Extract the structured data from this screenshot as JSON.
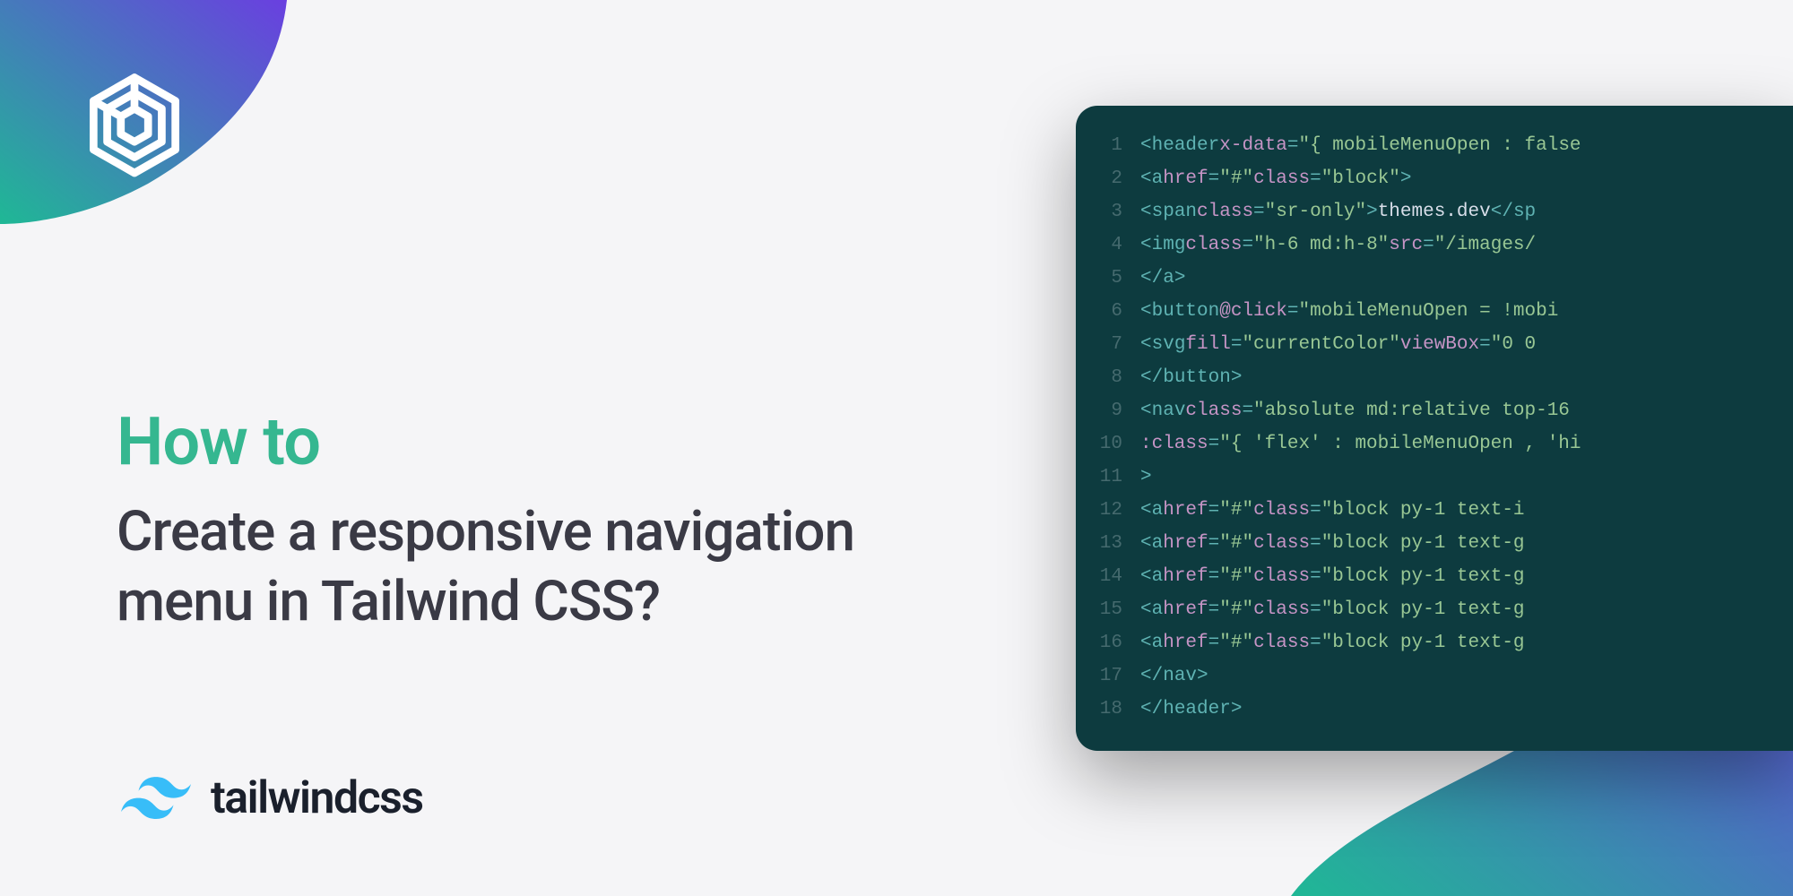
{
  "kicker": "How to",
  "title_line1": "Create a responsive navigation",
  "title_line2": "menu in Tailwind CSS?",
  "tailwind_label": "tailwindcss",
  "code": {
    "l1_tag": "header",
    "l1_attr1": "x-data",
    "l1_val1": "\"{ mobileMenuOpen : false ",
    "l2_tag": "a",
    "l2_attr1": "href",
    "l2_val1": "\"#\"",
    "l2_attr2": "class",
    "l2_val2": "\"block\"",
    "l3_tag": "span",
    "l3_attr1": "class",
    "l3_val1": "\"sr-only\"",
    "l3_text": "themes.dev",
    "l3_close": "sp",
    "l4_tag": "img",
    "l4_attr1": "class",
    "l4_val1": "\"h-6 md:h-8\"",
    "l4_attr2": "src",
    "l4_val2": "\"/images/",
    "l5_tag": "a",
    "l6_tag": "button",
    "l6_attr1": "@click",
    "l6_val1": "\"mobileMenuOpen = !mobi",
    "l7_tag": "svg",
    "l7_attr1": "fill",
    "l7_val1": "\"currentColor\"",
    "l7_attr2": "viewBox",
    "l7_val2": "\"0 0",
    "l8_tag": "button",
    "l9_tag": "nav",
    "l9_attr1": "class",
    "l9_val1": "\"absolute md:relative top-16",
    "l10_attr": ":class",
    "l10_val": "\"{ 'flex' : mobileMenuOpen , 'hi",
    "l11_punc": ">",
    "l12_tag": "a",
    "l12_href": "\"#\"",
    "l12_class_attr": "class",
    "l12_class_val": "\"block py-1 text-i",
    "l13_tag": "a",
    "l13_href": "\"#\"",
    "l13_class_attr": "class",
    "l13_class_val": "\"block py-1 text-g",
    "l14_tag": "a",
    "l14_href": "\"#\"",
    "l14_class_attr": "class",
    "l14_class_val": "\"block py-1 text-g",
    "l15_tag": "a",
    "l15_href": "\"#\"",
    "l15_class_attr": "class",
    "l15_class_val": "\"block py-1 text-g",
    "l16_tag": "a",
    "l16_href": "\"#\"",
    "l16_class_attr": "class",
    "l16_class_val": "\"block py-1 text-g",
    "l17_tag": "nav",
    "l18_tag": "header",
    "href_label": "href"
  }
}
